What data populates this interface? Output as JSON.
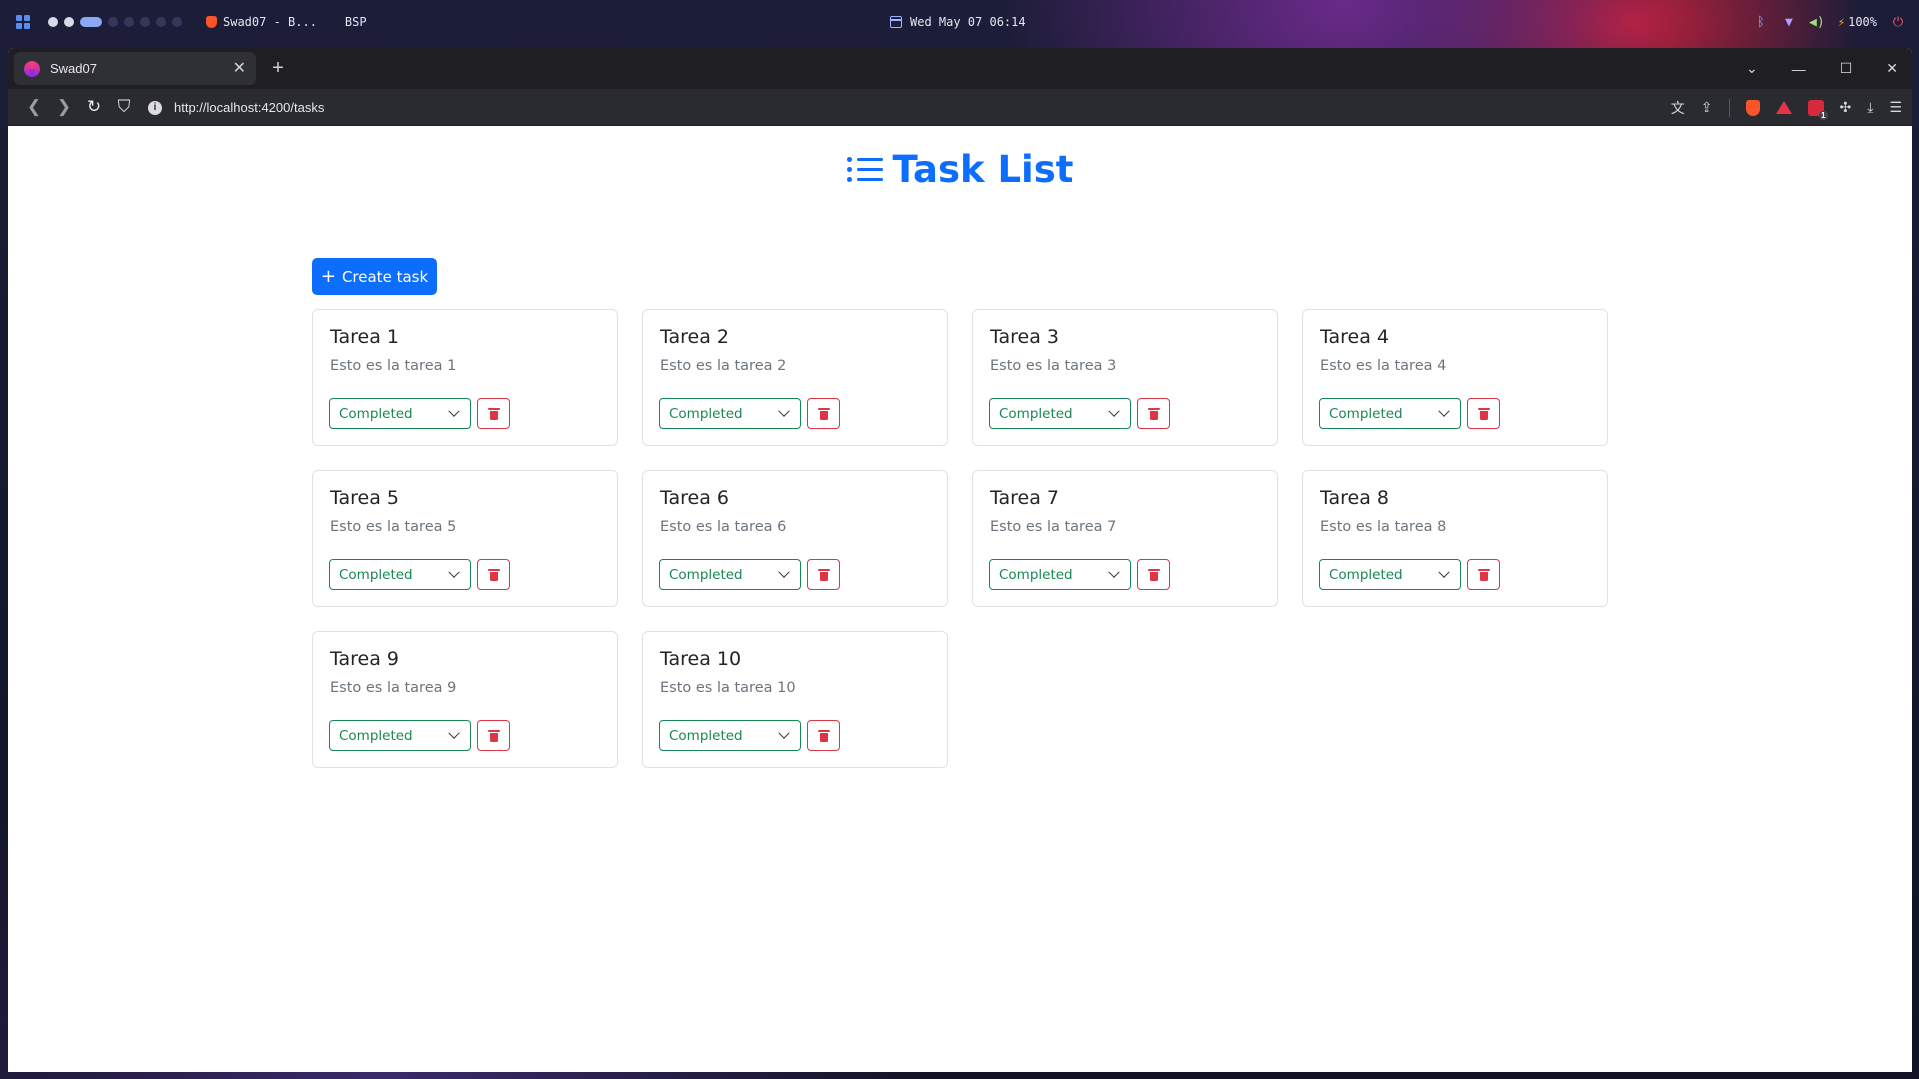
{
  "system_bar": {
    "window_title": "Swad07 - B...",
    "layout": "BSP",
    "datetime": "Wed May 07 06:14",
    "battery": "100%",
    "icons": [
      "workspace-grid-icon",
      "bluetooth-icon",
      "wifi-icon",
      "volume-icon",
      "battery-bolt-icon",
      "power-icon"
    ]
  },
  "browser": {
    "tab_title": "Swad07",
    "url": "http://localhost:4200/tasks",
    "extension_badge": "1"
  },
  "page": {
    "title": "Task List",
    "create_label": "Create task",
    "accent": "#0d6efd",
    "status_color": "#198754",
    "danger_color": "#dc3545",
    "tasks": [
      {
        "title": "Tarea 1",
        "description": "Esto es la tarea 1",
        "status": "Completed"
      },
      {
        "title": "Tarea 2",
        "description": "Esto es la tarea 2",
        "status": "Completed"
      },
      {
        "title": "Tarea 3",
        "description": "Esto es la tarea 3",
        "status": "Completed"
      },
      {
        "title": "Tarea 4",
        "description": "Esto es la tarea 4",
        "status": "Completed"
      },
      {
        "title": "Tarea 5",
        "description": "Esto es la tarea 5",
        "status": "Completed"
      },
      {
        "title": "Tarea 6",
        "description": "Esto es la tarea 6",
        "status": "Completed"
      },
      {
        "title": "Tarea 7",
        "description": "Esto es la tarea 7",
        "status": "Completed"
      },
      {
        "title": "Tarea 8",
        "description": "Esto es la tarea 8",
        "status": "Completed"
      },
      {
        "title": "Tarea 9",
        "description": "Esto es la tarea 9",
        "status": "Completed"
      },
      {
        "title": "Tarea 10",
        "description": "Esto es la tarea 10",
        "status": "Completed"
      }
    ]
  }
}
